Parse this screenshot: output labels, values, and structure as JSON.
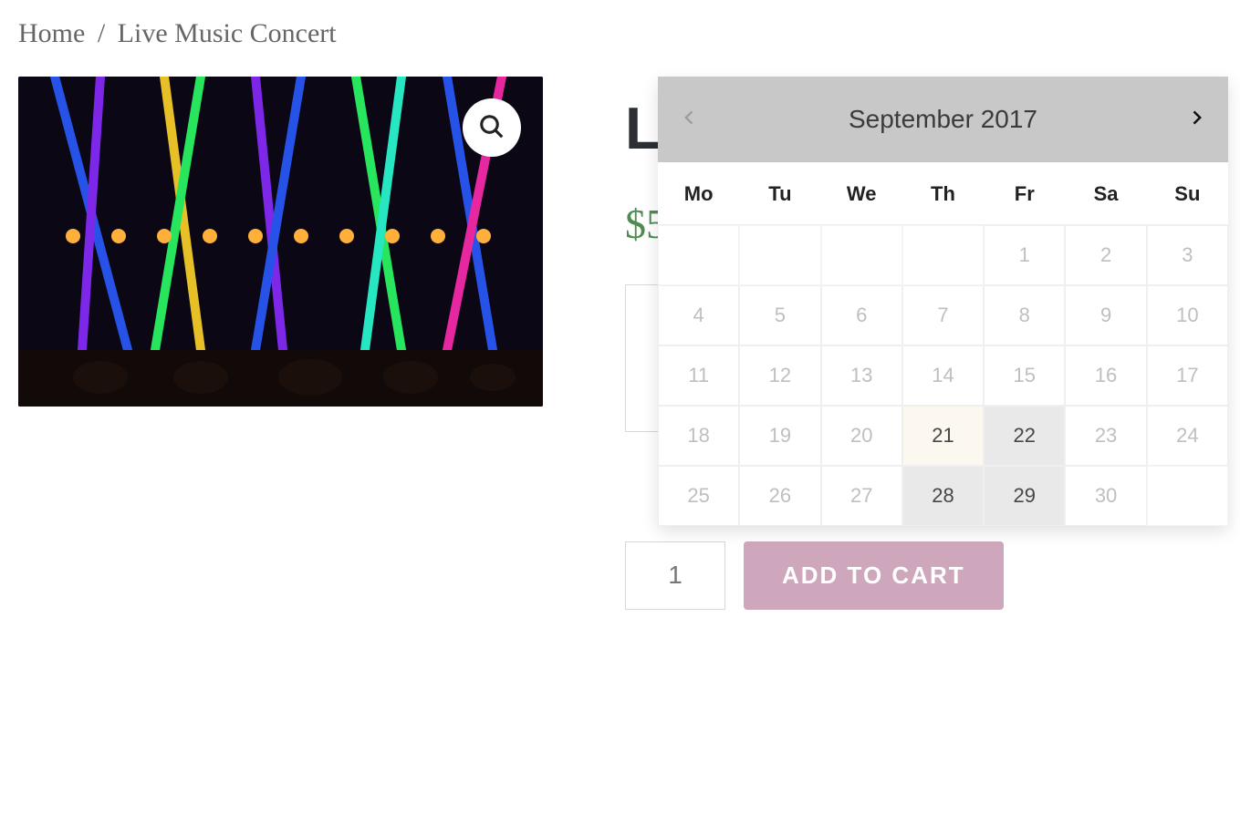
{
  "breadcrumb": {
    "home": "Home",
    "separator": "/",
    "current": "Live Music Concert"
  },
  "product": {
    "title_line1": "L",
    "title_full": "Live Music Concert",
    "price_prefix": "$",
    "price_visible": "$5"
  },
  "booking": {
    "date_value": "",
    "date_placeholder": ""
  },
  "cart": {
    "qty": "1",
    "add_label": "ADD TO CART"
  },
  "datepicker": {
    "title": "September 2017",
    "prev_enabled": false,
    "next_enabled": true,
    "dow": [
      "Mo",
      "Tu",
      "We",
      "Th",
      "Fr",
      "Sa",
      "Su"
    ],
    "cells": [
      {
        "n": "",
        "state": "empty"
      },
      {
        "n": "",
        "state": "empty"
      },
      {
        "n": "",
        "state": "empty"
      },
      {
        "n": "",
        "state": "empty"
      },
      {
        "n": "1",
        "state": "disabled"
      },
      {
        "n": "2",
        "state": "disabled"
      },
      {
        "n": "3",
        "state": "disabled"
      },
      {
        "n": "4",
        "state": "disabled"
      },
      {
        "n": "5",
        "state": "disabled"
      },
      {
        "n": "6",
        "state": "disabled"
      },
      {
        "n": "7",
        "state": "disabled"
      },
      {
        "n": "8",
        "state": "disabled"
      },
      {
        "n": "9",
        "state": "disabled"
      },
      {
        "n": "10",
        "state": "disabled"
      },
      {
        "n": "11",
        "state": "disabled"
      },
      {
        "n": "12",
        "state": "disabled"
      },
      {
        "n": "13",
        "state": "disabled"
      },
      {
        "n": "14",
        "state": "disabled"
      },
      {
        "n": "15",
        "state": "disabled"
      },
      {
        "n": "16",
        "state": "disabled"
      },
      {
        "n": "17",
        "state": "disabled"
      },
      {
        "n": "18",
        "state": "disabled"
      },
      {
        "n": "19",
        "state": "disabled"
      },
      {
        "n": "20",
        "state": "disabled"
      },
      {
        "n": "21",
        "state": "today"
      },
      {
        "n": "22",
        "state": "available"
      },
      {
        "n": "23",
        "state": "disabled"
      },
      {
        "n": "24",
        "state": "disabled"
      },
      {
        "n": "25",
        "state": "disabled"
      },
      {
        "n": "26",
        "state": "disabled"
      },
      {
        "n": "27",
        "state": "disabled"
      },
      {
        "n": "28",
        "state": "available"
      },
      {
        "n": "29",
        "state": "available"
      },
      {
        "n": "30",
        "state": "disabled"
      },
      {
        "n": "",
        "state": "empty"
      }
    ]
  }
}
